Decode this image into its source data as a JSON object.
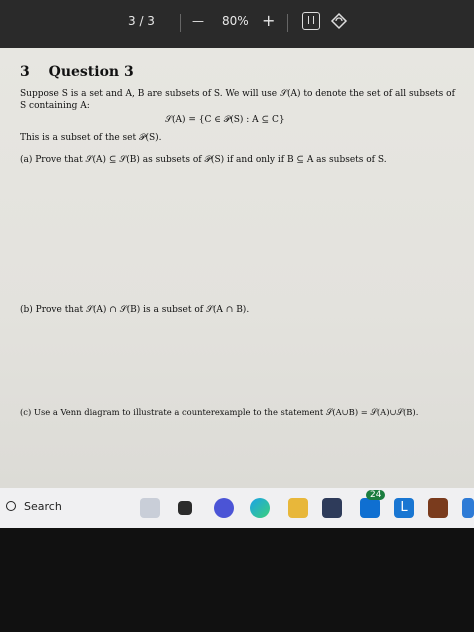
{
  "toolbar": {
    "page_indicator": "3 / 3",
    "zoom_out": "—",
    "zoom": "80%",
    "zoom_in": "+"
  },
  "document": {
    "section_number": "3",
    "section_title": "Question 3",
    "intro_line1": "Suppose S is a set and A, B are subsets of S. We will use 𝒮(A) to denote the set of all subsets of",
    "intro_line2": "S containing A:",
    "definition": "𝒮(A) = {C ∈ 𝒫(S) : A ⊆ C}",
    "subset_note": "This is a subset of the set 𝒫(S).",
    "part_a": "(a) Prove that 𝒮(A) ⊆ 𝒮(B) as subsets of 𝒫(S) if and only if B ⊆ A as subsets of S.",
    "part_b": "(b) Prove that 𝒮(A) ∩ 𝒮(B) is a subset of 𝒮(A ∩ B).",
    "part_c": "(c) Use a Venn diagram to illustrate a counterexample to the statement 𝒮(A∪B) = 𝒮(A)∪𝒮(B)."
  },
  "taskbar": {
    "search_label": "Search",
    "badge_count": "24"
  }
}
